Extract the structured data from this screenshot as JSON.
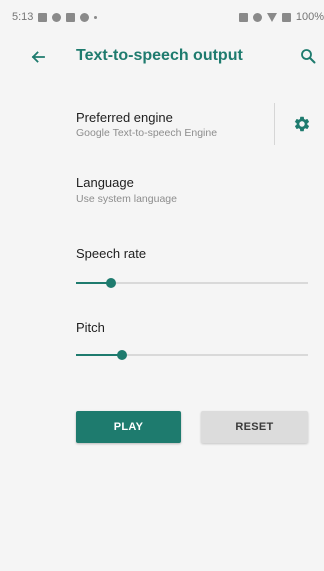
{
  "status_bar": {
    "time": "5:13",
    "battery": "100%"
  },
  "app_bar": {
    "title": "Text-to-speech output",
    "back_icon": "arrow-left-icon",
    "search_icon": "search-icon"
  },
  "preferences": {
    "engine": {
      "title": "Preferred engine",
      "summary": "Google Text-to-speech Engine",
      "settings_icon": "gear-icon"
    },
    "language": {
      "title": "Language",
      "summary": "Use system language"
    },
    "speech_rate": {
      "title": "Speech rate",
      "value": 0.15
    },
    "pitch": {
      "title": "Pitch",
      "value": 0.2
    }
  },
  "buttons": {
    "play": "PLAY",
    "reset": "RESET"
  },
  "colors": {
    "accent": "#1e7b6e",
    "background": "#f5f5f5"
  }
}
